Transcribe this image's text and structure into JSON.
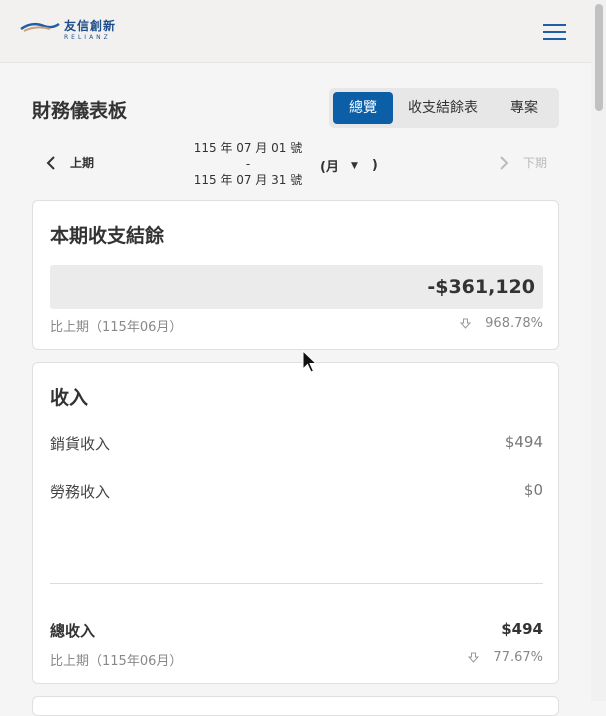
{
  "header": {
    "logo_cn": "友信創新",
    "logo_en": "RELIANZ",
    "menu_icon": "hamburger-menu-icon"
  },
  "page": {
    "title": "財務儀表板"
  },
  "tabs": [
    {
      "label": "總覽",
      "active": true
    },
    {
      "label": "收支結餘表",
      "active": false
    },
    {
      "label": "專案",
      "active": false
    }
  ],
  "period": {
    "prev_label": "上期",
    "start_date": "115 年 07 月 01 號",
    "separator": "-",
    "end_date": "115 年 07 月 31 號",
    "unit_open": "(月",
    "unit_close": ")",
    "next_label": "下期"
  },
  "balance_card": {
    "title": "本期收支結餘",
    "value": "-$361,120",
    "compare_label": "比上期（115年06月）",
    "compare_value": "968.78%"
  },
  "income_card": {
    "title": "收入",
    "items": [
      {
        "label": "銷貨收入",
        "value": "$494"
      },
      {
        "label": "勞務收入",
        "value": "$0"
      }
    ],
    "total_label": "總收入",
    "total_value": "$494",
    "compare_label": "比上期（115年06月）",
    "compare_value": "77.67%"
  },
  "colors": {
    "accent": "#0c5fa6",
    "header_bg": "#f3f1f0",
    "page_bg": "#f5f5f5"
  }
}
